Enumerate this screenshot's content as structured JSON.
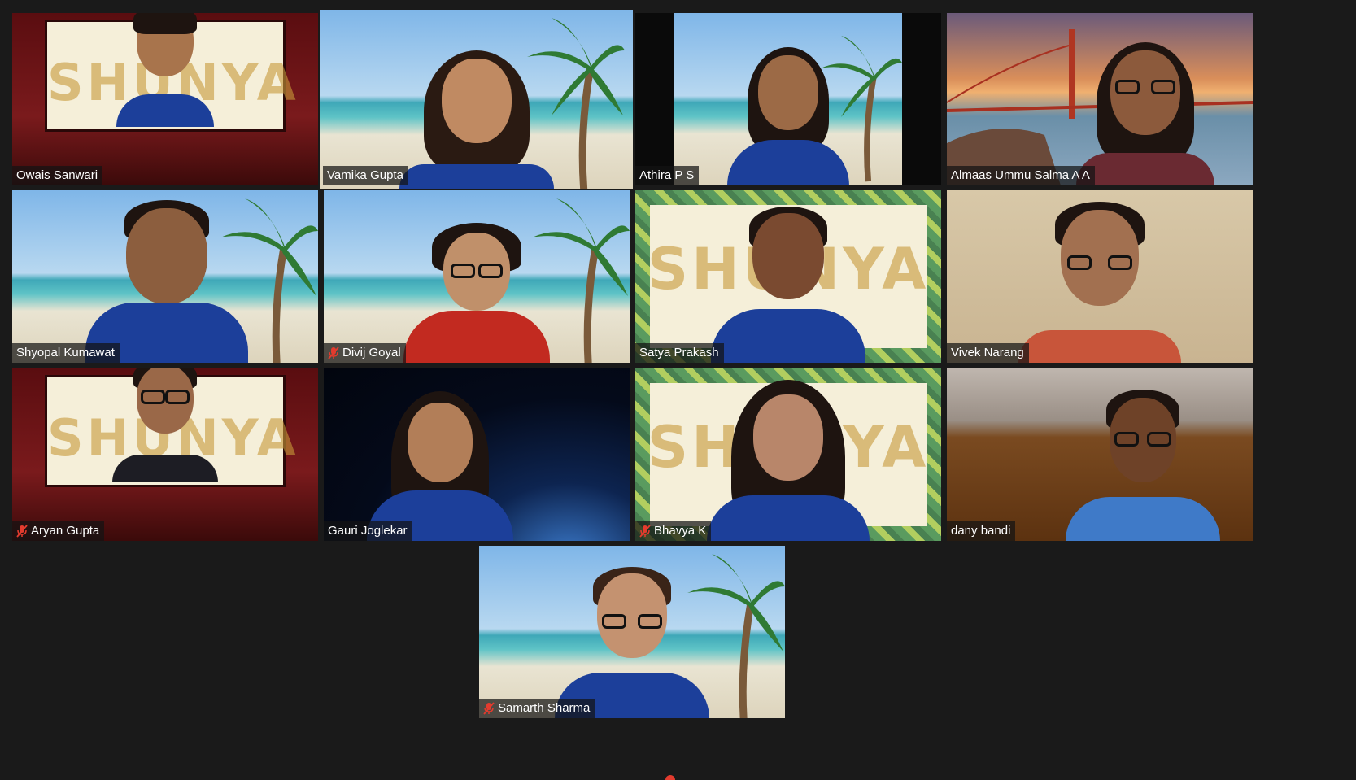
{
  "gallery": {
    "participants": [
      {
        "name": "Owais Sanwari",
        "muted": false,
        "active": false,
        "background": "shunya-theater"
      },
      {
        "name": "Vamika Gupta",
        "muted": false,
        "active": true,
        "background": "beach"
      },
      {
        "name": "Athira P S",
        "muted": false,
        "active": false,
        "background": "beach"
      },
      {
        "name": "Almaas Ummu Salma A A",
        "muted": false,
        "active": false,
        "background": "golden-gate-bridge"
      },
      {
        "name": "Shyopal Kumawat",
        "muted": false,
        "active": false,
        "background": "beach"
      },
      {
        "name": "Divij Goyal",
        "muted": true,
        "active": false,
        "background": "beach"
      },
      {
        "name": "Satya Prakash",
        "muted": false,
        "active": false,
        "background": "shunya-leaves"
      },
      {
        "name": "Vivek Narang",
        "muted": false,
        "active": false,
        "background": "room"
      },
      {
        "name": "Aryan Gupta",
        "muted": true,
        "active": false,
        "background": "shunya-theater"
      },
      {
        "name": "Gauri Joglekar",
        "muted": false,
        "active": false,
        "background": "space-earth"
      },
      {
        "name": "Bhavya K",
        "muted": true,
        "active": false,
        "background": "shunya-leaves"
      },
      {
        "name": "dany bandi",
        "muted": false,
        "active": false,
        "background": "kitchen"
      },
      {
        "name": "Samarth Sharma",
        "muted": true,
        "active": false,
        "background": "beach"
      }
    ]
  },
  "colors": {
    "background": "#1a1a1a",
    "active_speaker_border": "#e8e85a",
    "mute_icon": "#e33b2e",
    "name_tag_text": "#ffffff"
  },
  "icons": {
    "mute": "microphone-muted-icon"
  }
}
